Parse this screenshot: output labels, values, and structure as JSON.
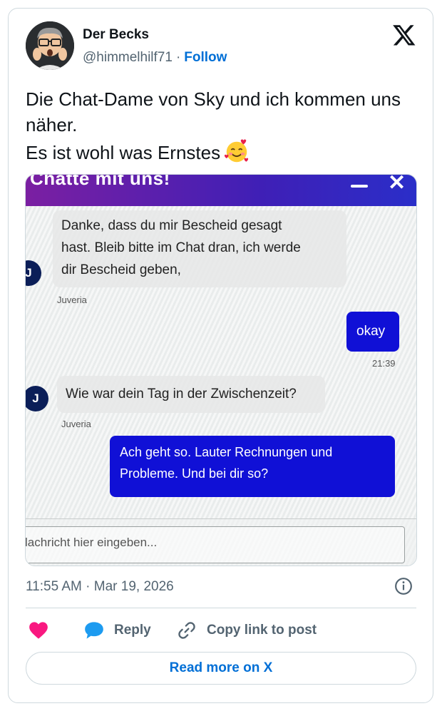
{
  "author": {
    "name": "Der Becks",
    "handle": "@himmelhilf71",
    "separator": "·",
    "follow_label": "Follow",
    "avatar_icon": "memoji-avatar-icon"
  },
  "tweet": {
    "lines": [
      "Die Chat-Dame von Sky und ich kommen uns näher.",
      "Es ist wohl was Ernstes"
    ],
    "emoji": "smiling-face-with-hearts"
  },
  "photo": {
    "chat_title": "Chatte mit uns!",
    "messages": {
      "agent1": [
        "Danke, dass du mir Bescheid gesagt",
        "hast. Bleib bitte im Chat dran, ich werde",
        "dir Bescheid geben,"
      ],
      "agent1_name": "Juveria",
      "agent1_avatar": "J",
      "user1": "okay",
      "user1_time": "21:39",
      "agent2": "Wie war dein Tag in der Zwischenzeit?",
      "agent2_name": "Juveria",
      "agent2_avatar": "J",
      "user2": [
        "Ach geht so. Lauter Rechnungen und",
        "Probleme. Und bei dir so?"
      ]
    },
    "input_placeholder": "lachricht hier eingeben..."
  },
  "meta": {
    "timestamp": "11:55 AM · Mar 19, 2026"
  },
  "actions": {
    "like_count": "",
    "reply_label": "Reply",
    "copy_label": "Copy link to post"
  },
  "read_more_label": "Read more on X",
  "colors": {
    "accent": "#006fd6",
    "like": "#f91880",
    "reply": "#1d9bf0",
    "user_bubble": "#1010d6"
  }
}
